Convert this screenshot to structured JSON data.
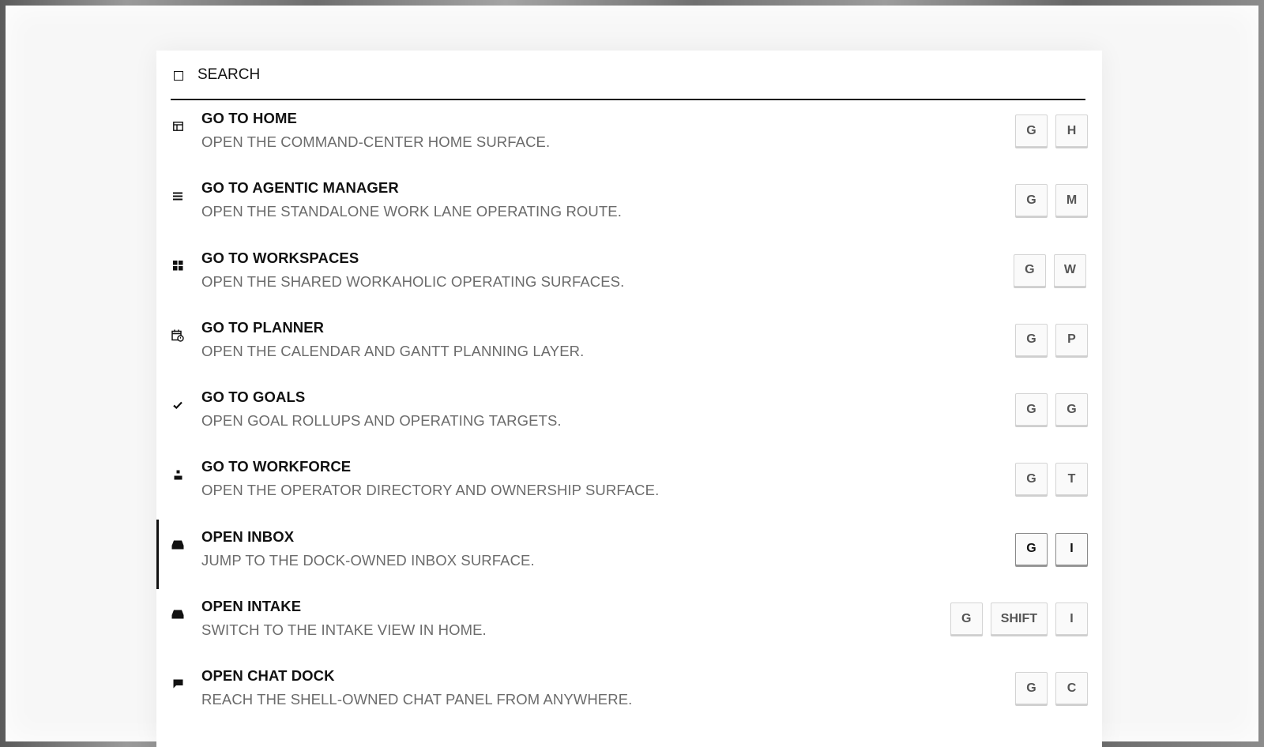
{
  "search": {
    "placeholder": "SEARCH"
  },
  "commands": [
    {
      "title": "GO TO HOME",
      "desc": "OPEN THE COMMAND-CENTER HOME SURFACE.",
      "icon": "home-layout-icon",
      "keys": [
        "G",
        "H"
      ],
      "active": false
    },
    {
      "title": "GO TO AGENTIC MANAGER",
      "desc": "OPEN THE STANDALONE WORK LANE OPERATING ROUTE.",
      "icon": "list-lines-icon",
      "keys": [
        "G",
        "M"
      ],
      "active": false
    },
    {
      "title": "GO TO WORKSPACES",
      "desc": "OPEN THE SHARED WORKAHOLIC OPERATING SURFACES.",
      "icon": "grid-icon",
      "keys": [
        "G",
        "W"
      ],
      "active": false
    },
    {
      "title": "GO TO PLANNER",
      "desc": "OPEN THE CALENDAR AND GANTT PLANNING LAYER.",
      "icon": "calendar-clock-icon",
      "keys": [
        "G",
        "P"
      ],
      "active": false
    },
    {
      "title": "GO TO GOALS",
      "desc": "OPEN GOAL ROLLUPS AND OPERATING TARGETS.",
      "icon": "checkmark-icon",
      "keys": [
        "G",
        "G"
      ],
      "active": false
    },
    {
      "title": "GO TO WORKFORCE",
      "desc": "OPEN THE OPERATOR DIRECTORY AND OWNERSHIP SURFACE.",
      "icon": "person-icon",
      "keys": [
        "G",
        "T"
      ],
      "active": false
    },
    {
      "title": "OPEN INBOX",
      "desc": "JUMP TO THE DOCK-OWNED INBOX SURFACE.",
      "icon": "inbox-tray-icon",
      "keys": [
        "G",
        "I"
      ],
      "active": true
    },
    {
      "title": "OPEN INTAKE",
      "desc": "SWITCH TO THE INTAKE VIEW IN HOME.",
      "icon": "inbox-tray-icon",
      "keys": [
        "G",
        "SHIFT",
        "I"
      ],
      "active": false
    },
    {
      "title": "OPEN CHAT DOCK",
      "desc": "REACH THE SHELL-OWNED CHAT PANEL FROM ANYWHERE.",
      "icon": "chat-bubble-icon",
      "keys": [
        "G",
        "C"
      ],
      "active": false
    }
  ]
}
